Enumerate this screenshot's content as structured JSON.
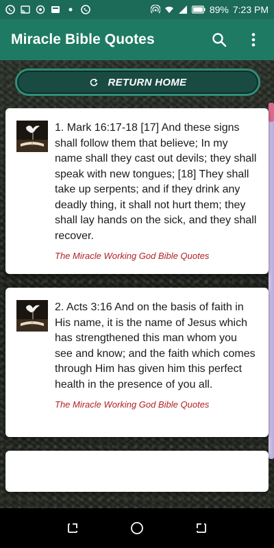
{
  "status_bar": {
    "battery": "89%",
    "time": "7:23 PM"
  },
  "app_bar": {
    "title": "Miracle Bible Quotes"
  },
  "return_button": {
    "label": "RETURN HOME"
  },
  "quotes": [
    {
      "text": "1. Mark 16:17-18 [17] And these signs shall follow them that believe; In my name shall they cast out devils; they shall speak with new tongues; [18] They shall take up serpents; and if they drink any deadly thing, it shall not hurt them; they shall lay hands on the sick, and they shall recover.",
      "source": "The Miracle Working God Bible Quotes"
    },
    {
      "text": "2. Acts 3:16 And on the basis of faith in His name, it is the name of Jesus which has strengthened this man whom you see and know; and the faith which comes through Him has given him this perfect health in the presence of you all.",
      "source": "The Miracle Working God Bible Quotes"
    }
  ],
  "colors": {
    "app_bar": "#1f7a63",
    "status_bar": "#1c6a58",
    "source_text": "#b22024"
  }
}
